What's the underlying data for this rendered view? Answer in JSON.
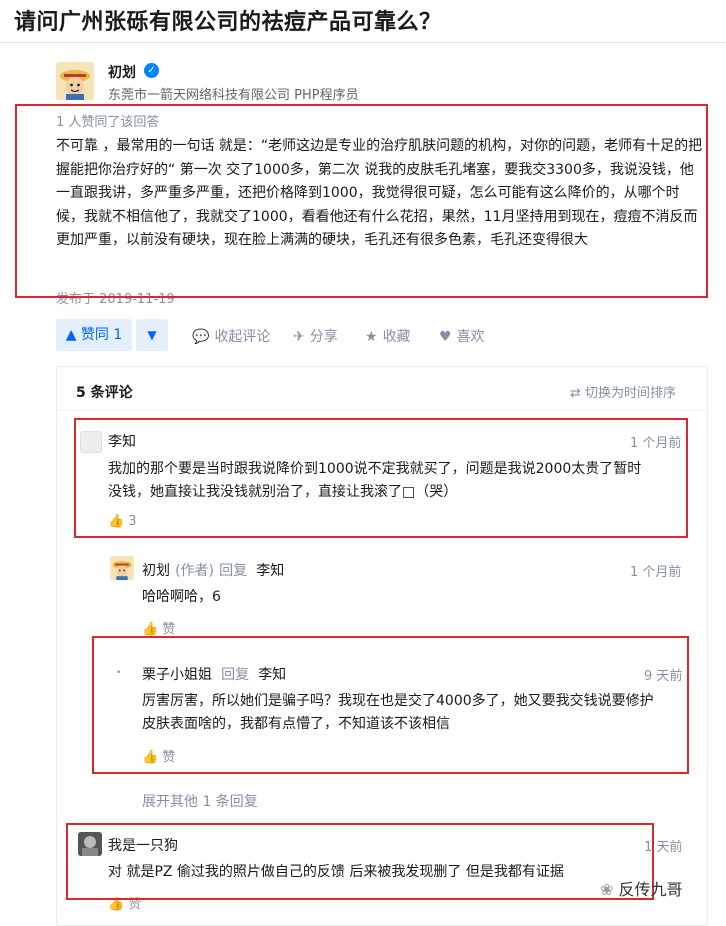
{
  "question": {
    "title": "请问广州张砾有限公司的祛痘产品可靠么？"
  },
  "answer": {
    "author": {
      "name": "初划",
      "bio": "东莞市一箭天网络科技有限公司 PHP程序员"
    },
    "upvote_note": "1 人赞同了该回答",
    "content": "不可靠 ，最常用的一句话 就是：“老师这边是专业的治疗肌肤问题的机构，对你的问题，老师有十足的把握能把你治疗好的“ 第一次 交了1000多，第二次 说我的皮肤毛孔堵塞，要我交3300多，我说没钱，他一直跟我讲，多严重多严重，还把价格降到1000，我觉得很可疑，怎么可能有这么降价的，从哪个时候，我就不相信他了，我就交了1000，看看他还有什么花招，果然，11月坚持用到现在，痘痘不消反而更加严重，以前没有硬块，现在脸上满满的硬块，毛孔还有很多色素，毛孔还变得很大",
    "published": "发布于 2019-11-19"
  },
  "actions": {
    "upvote_label": "▲ 赞同 1",
    "downvote_label": "▼",
    "collapse_comments": "收起评论",
    "share": "分享",
    "favorite": "收藏",
    "like": "喜欢"
  },
  "comments": {
    "header": "5 条评论",
    "sort_label": "切换为时间排序",
    "items": [
      {
        "name": "李知",
        "time": "1 个月前",
        "text_line1": "我加的那个要是当时跟我说降价到1000说不定我就买了，问题是我说2000太贵了暂时",
        "text_line2": "没钱，她直接让我没钱就别治了，直接让我滚了□（哭）",
        "likes": "3"
      },
      {
        "name": "初划",
        "role": "(作者)",
        "reply": "回复",
        "reply_to": "李知",
        "time": "1 个月前",
        "text_line1": "哈哈啊哈，6",
        "likes": "赞"
      },
      {
        "name": "栗子小姐姐",
        "reply": "回复",
        "reply_to": "李知",
        "time": "9 天前",
        "text_line1": "厉害厉害，所以她们是骗子吗？我现在也是交了4000多了，她又要我交钱说要修护",
        "text_line2": "皮肤表面啥的，我都有点懵了，不知道该不该相信",
        "likes": "赞"
      },
      {
        "name": "我是一只狗",
        "time": "1 天前",
        "text_line1": "对 就是PZ 偷过我的照片做自己的反馈 后来被我发现删了 但是我都有证据",
        "likes": "赞"
      }
    ],
    "expand_more": "展开其他 1 条回复"
  },
  "watermark": "反传九哥"
}
